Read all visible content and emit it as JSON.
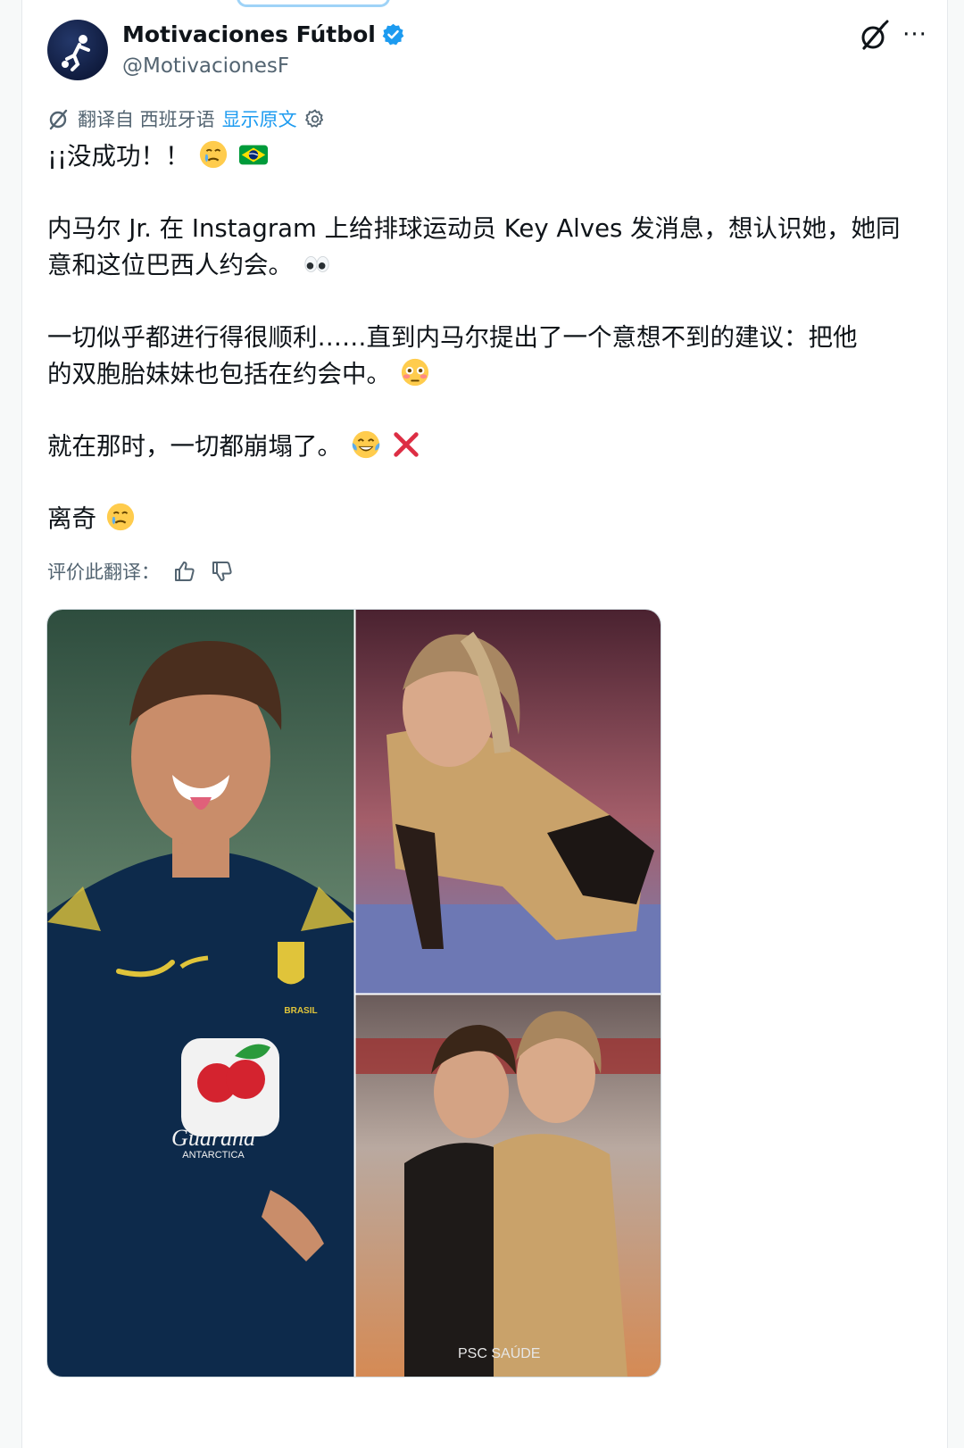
{
  "tweet": {
    "author": {
      "display_name": "Motivaciones Fútbol",
      "handle": "@MotivacionesF",
      "verified": true
    },
    "translation": {
      "label": "翻译自 西班牙语",
      "show_original": "显示原文"
    },
    "text": {
      "line1": "¡¡没成功！！",
      "line2a": "内马尔 Jr. 在 Instagram 上给排球运动员 Key Alves 发消息，想认识她，她同",
      "line2b": "意和这位巴西人约会。",
      "line3a": "一切似乎都进行得很顺利……直到内马尔提出了一个意想不到的建议：把他",
      "line3b": "的双胞胎妹妹也包括在约会中。",
      "line4": "就在那时，一切都崩塌了。",
      "line5": "离奇"
    },
    "rate_translation_label": "评价此翻译："
  },
  "media_text": {
    "cbf_crest": "BRASIL",
    "sponsor": "Guaraná",
    "sponsor_sub": "ANTARCTICA",
    "shorts_sponsor": "PSC SAÚDE"
  },
  "icons": [
    "verified-badge-icon",
    "grok-icon",
    "more-icon",
    "translate-icon",
    "settings-icon",
    "thumbs-up-icon",
    "thumbs-down-icon"
  ],
  "colors": {
    "accent": "#1d9bf0",
    "text": "#0f1419",
    "secondary": "#536471"
  }
}
